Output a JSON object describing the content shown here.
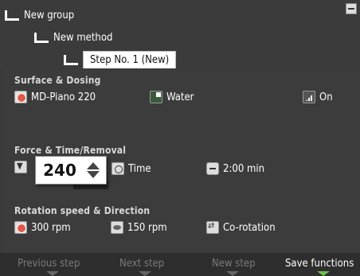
{
  "tree": {
    "group": "New group",
    "method": "New method",
    "step_tab": "Step No. 1 (New)"
  },
  "surface_dosing": {
    "title": "Surface & Dosing",
    "disc": "MD-Piano 220",
    "lubricant": "Water",
    "dosing": "On"
  },
  "force_time": {
    "title": "Force & Time/Removal",
    "force_value": "240",
    "mode": "Time",
    "duration": "2:00 min"
  },
  "rotation": {
    "title": "Rotation speed & Direction",
    "disc_speed": "300 rpm",
    "head_speed": "150 rpm",
    "direction": "Co-rotation"
  },
  "function_bar": {
    "previous_step": "Previous step",
    "next_step": "Next step",
    "new_step": "New step",
    "save_functions": "Save functions"
  },
  "colors": {
    "background": "#3a3a3a",
    "active_marker": "#6bc24a",
    "disc_accent": "#e05a4a"
  }
}
